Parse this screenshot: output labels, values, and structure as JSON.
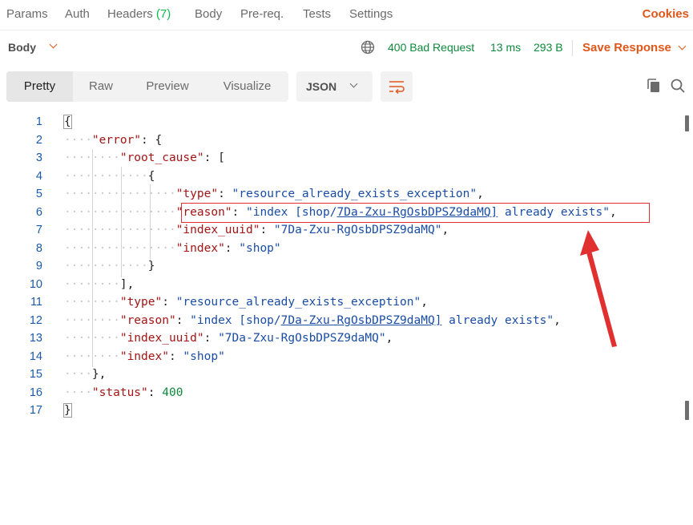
{
  "tabs": {
    "params": "Params",
    "auth": "Auth",
    "headers": "Headers",
    "headers_count": "(7)",
    "body": "Body",
    "prereq": "Pre-req.",
    "tests": "Tests",
    "settings": "Settings",
    "cookies": "Cookies"
  },
  "response": {
    "body_label": "Body",
    "status": "400 Bad Request",
    "time": "13 ms",
    "size": "293 B",
    "save_label": "Save Response"
  },
  "view": {
    "pretty": "Pretty",
    "raw": "Raw",
    "preview": "Preview",
    "visualize": "Visualize",
    "format": "JSON"
  },
  "line_numbers": [
    "1",
    "2",
    "3",
    "4",
    "5",
    "6",
    "7",
    "8",
    "9",
    "10",
    "11",
    "12",
    "13",
    "14",
    "15",
    "16",
    "17"
  ],
  "code": {
    "l1": "{",
    "l2_key": "\"error\"",
    "l2_punct": ": {",
    "l3_key": "\"root_cause\"",
    "l3_punct": ": [",
    "l4": "{",
    "l5_key": "\"type\"",
    "l5_val": "\"resource_already_exists_exception\"",
    "l6_key": "\"reason\"",
    "l6_val_pre": "\"index [shop/",
    "l6_val_link": "7Da-Zxu-RgOsbDPSZ9daMQ]",
    "l6_val_post": " already exists\"",
    "l7_key": "\"index_uuid\"",
    "l7_val": "\"7Da-Zxu-RgOsbDPSZ9daMQ\"",
    "l8_key": "\"index\"",
    "l8_val": "\"shop\"",
    "l9": "}",
    "l10": "],",
    "l11_key": "\"type\"",
    "l11_val": "\"resource_already_exists_exception\"",
    "l12_key": "\"reason\"",
    "l12_val_pre": "\"index [shop/",
    "l12_val_link": "7Da-Zxu-RgOsbDPSZ9daMQ]",
    "l12_val_post": " already exists\"",
    "l13_key": "\"index_uuid\"",
    "l13_val": "\"7Da-Zxu-RgOsbDPSZ9daMQ\"",
    "l14_key": "\"index\"",
    "l14_val": "\"shop\"",
    "l15": "},",
    "l16_key": "\"status\"",
    "l16_val": "400",
    "l17": "}"
  },
  "colors": {
    "accent": "#e0571b",
    "status_ok": "#0f8a3c",
    "annotation": "#e03030"
  },
  "icons": {
    "globe": "globe-icon",
    "wrap": "wrap-lines-icon",
    "copy": "copy-icon",
    "search": "search-icon"
  }
}
